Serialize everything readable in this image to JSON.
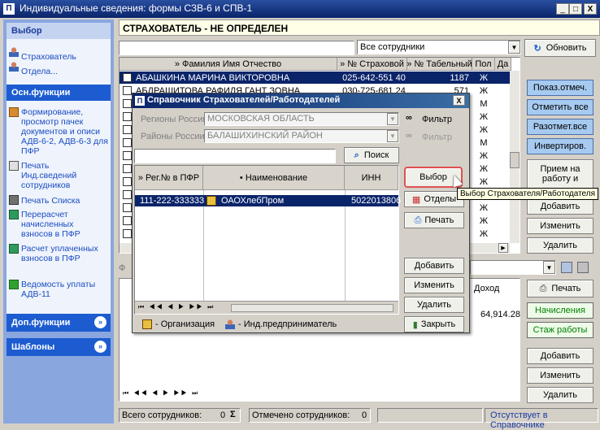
{
  "window": {
    "title": "Индивидуальные сведения: формы СЗВ-6 и СПВ-1",
    "controls": [
      "_",
      "□",
      "X"
    ]
  },
  "insurer_banner": "СТРАХОВАТЕЛЬ - НЕ ОПРЕДЕЛЕН",
  "employees_filter": "Все сотрудники",
  "refresh_label": "Обновить",
  "sidebar": {
    "select_section": {
      "title": "Выбор",
      "items": [
        "Страхователь",
        "Отдела..."
      ]
    },
    "main_section": {
      "title": "Осн.функции",
      "items": [
        "Формирование, просмотр пачек документов и описи АДВ-6-2, АДВ-6-3 для ПФР",
        "Печать Инд.сведений сотрудников",
        "Печать Списка",
        "Перерасчет начисленных взносов в ПФР",
        "Расчет уплаченных взносов в ПФР",
        "Ведомость уплаты АДВ-11"
      ]
    },
    "extra_section": {
      "title": "Доп.функции"
    },
    "templates_section": {
      "title": "Шаблоны"
    }
  },
  "main_table": {
    "columns": [
      "» Фамилия Имя Отчество",
      "» № Страховой",
      "» № Табельный",
      "Пол",
      "Да"
    ],
    "rows": [
      {
        "name": "АБАШКИНА МАРИНА ВИКТОРОВНА",
        "snils": "025-642-551 40",
        "tab": "1187",
        "sex": "Ж",
        "selected": true
      },
      {
        "name": "АБДРАШИТОВА РАФИЛЯ ГАНТ ЗОВНА",
        "snils": "030-725-681 24",
        "tab": "571",
        "sex": "Ж"
      },
      {
        "name": "",
        "snils": "",
        "tab": "",
        "sex": "М"
      },
      {
        "name": "",
        "snils": "",
        "tab": "",
        "sex": "Ж"
      },
      {
        "name": "",
        "snils": "",
        "tab": "",
        "sex": "Ж"
      },
      {
        "name": "",
        "snils": "",
        "tab": "",
        "sex": "М"
      },
      {
        "name": "",
        "snils": "",
        "tab": "",
        "sex": "Ж"
      },
      {
        "name": "",
        "snils": "",
        "tab": "",
        "sex": "Ж"
      },
      {
        "name": "",
        "snils": "",
        "tab": "",
        "sex": "Ж"
      },
      {
        "name": "",
        "snils": "",
        "tab": "",
        "sex": "Ж"
      },
      {
        "name": "",
        "snils": "",
        "tab": "",
        "sex": "Ж"
      },
      {
        "name": "",
        "snils": "",
        "tab": "",
        "sex": "Ж"
      },
      {
        "name": "",
        "snils": "",
        "tab": "",
        "sex": "Ж"
      }
    ]
  },
  "right_buttons": {
    "show_marked": "Показ.отмеч.",
    "mark_all": "Отметить все",
    "unmark_all": "Разотмет.все",
    "invert": "Инвертиров.",
    "hire": "Прием на работу и",
    "add": "Добавить",
    "edit": "Изменить",
    "delete": "Удалить",
    "print": "Печать",
    "accruals": "Начисления",
    "seniority": "Стаж работы",
    "add2": "Добавить",
    "edit2": "Изменить",
    "delete2": "Удалить"
  },
  "lower_panel": {
    "prefix_letter": "Ф",
    "col_income": "Доход",
    "income_value": "64,914.28"
  },
  "status_bar": {
    "total_label": "Всего сотрудников:",
    "total_value": "0",
    "marked_label": "Отмечено сотрудников:",
    "marked_value": "0",
    "catalog_status": "Отсутствует в Справочнике"
  },
  "dialog": {
    "title": "Справочник Страхователей/Работодателей",
    "regions_label": "Регионы России:",
    "regions_value": "МОСКОВСКАЯ ОБЛАСТЬ",
    "districts_label": "Районы России:",
    "districts_value": "БАЛАШИХИНСКИЙ РАЙОН",
    "filter_label": "Фильтр",
    "filter2_label": "Фильтр",
    "search_label": "Поиск",
    "columns": [
      "» Рег.№ в ПФР",
      "• Наименование",
      "ИНН"
    ],
    "row": {
      "reg": "111-222-333333",
      "name": "ОАОХлебПром",
      "inn": "5022013806"
    },
    "select_label": "Выбор",
    "departments_label": "Отделы",
    "print_label": "Печать",
    "add_label": "Добавить",
    "edit_label": "Изменить",
    "delete_label": "Удалить",
    "close_label": "Закрыть",
    "legend_org": "- Организация",
    "legend_ip": "- Инд.предприниматель"
  },
  "tooltip": "Выбор Страхователя/Работодателя",
  "colors": {
    "title_bar": "#0a246a",
    "selection": "#0a246a",
    "sidebar_header": "#1c5cd0",
    "banner": "#ffffe8"
  }
}
